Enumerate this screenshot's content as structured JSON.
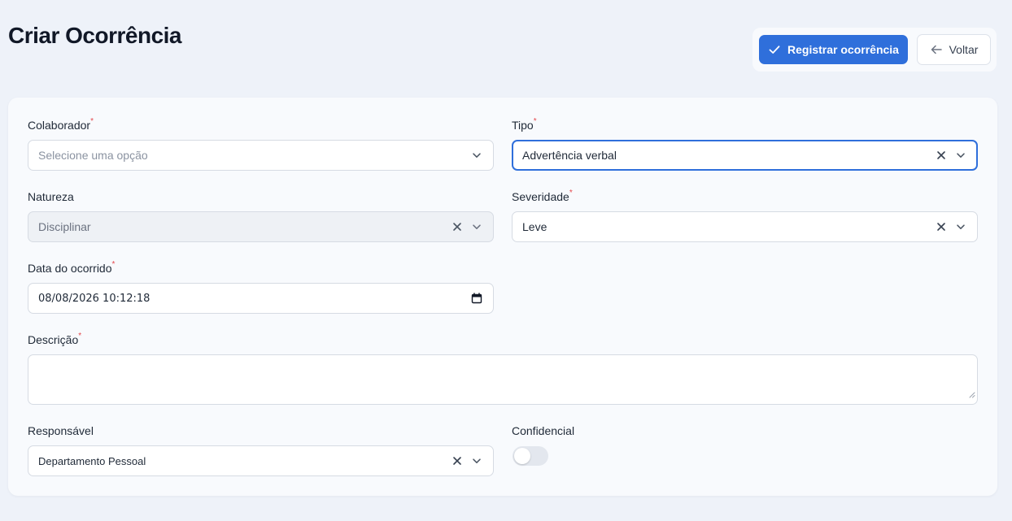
{
  "header": {
    "title": "Criar Ocorrência",
    "register_label": "Registrar ocorrência",
    "back_label": "Voltar"
  },
  "form": {
    "colaborador": {
      "label": "Colaborador",
      "required": "*",
      "value": "",
      "placeholder": "Selecione uma opção"
    },
    "tipo": {
      "label": "Tipo",
      "required": "*",
      "value": "Advertência verbal"
    },
    "natureza": {
      "label": "Natureza",
      "value": "Disciplinar"
    },
    "severidade": {
      "label": "Severidade",
      "required": "*",
      "value": "Leve"
    },
    "data_ocorrido": {
      "label": "Data do ocorrido",
      "required": "*",
      "value": "08/08/2026 10:12:18"
    },
    "descricao": {
      "label": "Descrição",
      "required": "*",
      "value": ""
    },
    "responsavel": {
      "label": "Responsável",
      "value": "Departamento Pessoal"
    },
    "confidencial": {
      "label": "Confidencial",
      "on": false
    }
  },
  "colors": {
    "primary": "#2f6fdb",
    "required": "#e5484d",
    "page_background": "#eef2f9",
    "card_background": "#f8fafd"
  },
  "icons": {
    "register": "check-icon",
    "back": "arrow-left-icon",
    "clear": "close-icon",
    "dropdown": "chevron-down-icon",
    "calendar": "calendar-icon",
    "resize": "resize-grip-icon"
  }
}
